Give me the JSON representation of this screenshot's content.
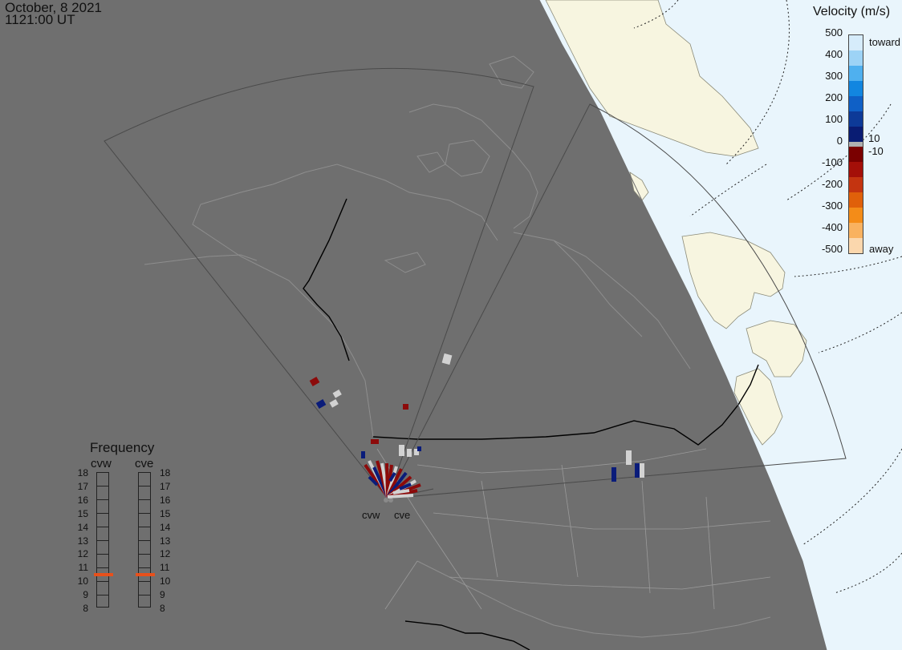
{
  "header": {
    "date": "October, 8 2021",
    "time": "1121:00 UT"
  },
  "colorbar": {
    "title": "Velocity (m/s)",
    "ticks": [
      "500",
      "400",
      "300",
      "200",
      "100",
      "0",
      "-100",
      "-200",
      "-300",
      "-400",
      "-500"
    ],
    "inner_pos": "10",
    "inner_neg": "-10",
    "toward_label": "toward",
    "away_label": "away",
    "colors": [
      "#d6ecfb",
      "#9dd3f6",
      "#4fb0ef",
      "#1286e0",
      "#0f60c6",
      "#0d3a98",
      "#091c73",
      "#b0b0b0",
      "#7a0000",
      "#a40f08",
      "#c43410",
      "#e0600a",
      "#f48c18",
      "#f9b260",
      "#fbd7ad"
    ]
  },
  "frequency": {
    "title": "Frequency",
    "radars": [
      {
        "name": "cvw",
        "value_mhz": 10.5
      },
      {
        "name": "cve",
        "value_mhz": 10.5
      }
    ],
    "scale": [
      "18",
      "17",
      "16",
      "15",
      "14",
      "13",
      "12",
      "11",
      "10",
      "9",
      "8"
    ],
    "marker_color": "#e8501b"
  },
  "radars": [
    {
      "name": "cvw",
      "label": "cvw"
    },
    {
      "name": "cve",
      "label": "cve"
    }
  ],
  "colors": {
    "night": "#6f6f6f",
    "ocean_day": "#e9f5fc",
    "land_day": "#f7f5e0",
    "coast_night": "#8a8a8a",
    "border": "#000000",
    "fov": "#4a4a4a",
    "toward": "#0a1c7a",
    "away": "#8c0a0a",
    "low": "#d2d2d2"
  }
}
